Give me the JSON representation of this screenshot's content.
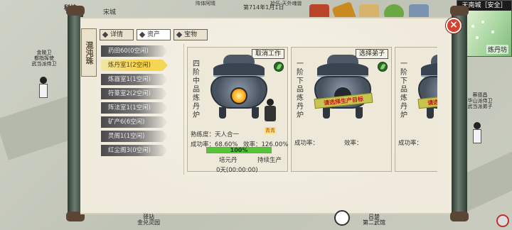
{
  "window": {
    "title_seal": "混沌珠"
  },
  "tabs": [
    {
      "label": "详情"
    },
    {
      "label": "资产"
    },
    {
      "label": "宝物"
    }
  ],
  "sidebar": {
    "items": [
      {
        "label": "药田60(0空闲)"
      },
      {
        "label": "炼丹室1(2空闲)"
      },
      {
        "label": "炼器室1(1空闲)"
      },
      {
        "label": "符篆室2(2空闲)"
      },
      {
        "label": "阵法室1(1空闲)"
      },
      {
        "label": "矿产6(6空闲)"
      },
      {
        "label": "灵阁1(1空闲)"
      },
      {
        "label": "红尘阁3(0空闲)"
      }
    ]
  },
  "cards": [
    {
      "vertical_title": "四阶中品炼丹炉",
      "action": "取消工作",
      "worker_name": "青青",
      "proficiency": "熟练度：天人合一",
      "success_rate": "成功率：68.60%",
      "efficiency": "效率：126.00%",
      "progress_percent": 100,
      "progress_label": "100%",
      "product": "培元丹",
      "mode": "持续生产",
      "time": "0天(00:00:00)"
    },
    {
      "vertical_title": "一阶下品炼丹炉",
      "action": "选择弟子",
      "empty_sign": "请选择生产目标",
      "success_rate": "成功率：",
      "efficiency": "效率："
    },
    {
      "vertical_title": "一阶下品炼丹炉",
      "empty_sign": "请选择生产目标",
      "success_rate": "成功率："
    }
  ],
  "hud": {
    "top_texts": [
      "科技",
      "宋城",
      "阵体阿晴",
      "第714年1月1日",
      "拾伍-天外魂兽"
    ],
    "minimap_title": "天南城［安全］",
    "minimap_label": "炼丹坊",
    "left_npc_label": "金陵卫\n都指挥使\n武当派侍卫",
    "right_npc_label": "蔡德昌\n华山派侍卫\n武当派弟子",
    "bottom_left": "驿站\n金兑灵园",
    "bottom_right": "吕楚\n第二武馆"
  },
  "colors": {
    "selected_tab_item": "#f6d34a",
    "progress_fill": "#58c23b",
    "close_red": "#d8402e"
  }
}
